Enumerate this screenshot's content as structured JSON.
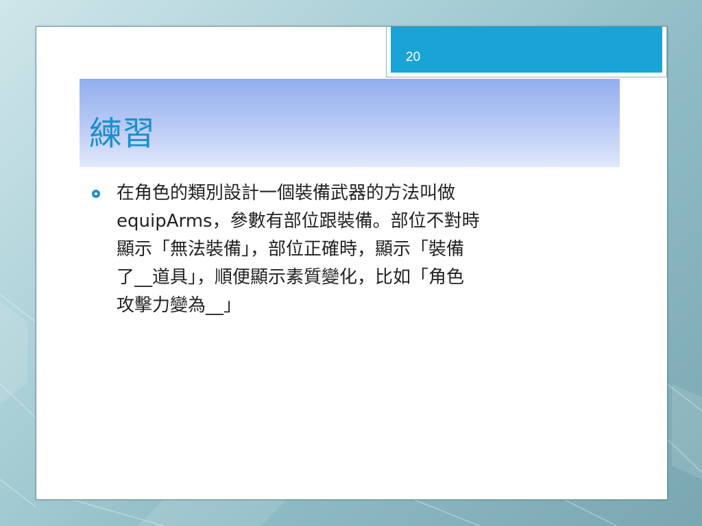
{
  "slide": {
    "number": "20",
    "title": "練習",
    "bullets": [
      {
        "icon": "circle-bullet-icon",
        "text": "在角色的類別設計一個裝備武器的方法叫做\nequipArms，參數有部位跟裝備。部位不對時\n顯示「無法裝備」，部位正確時，顯示「裝備\n了__道具」，順便顯示素質變化，比如「角色\n攻擊力變為__」"
      }
    ]
  },
  "colors": {
    "accent": "#1a8fd0",
    "number_tab": "#1aa3d6",
    "title_band_top": "#93aef0",
    "title_band_bottom": "#e0e8fb",
    "text": "#222222"
  }
}
